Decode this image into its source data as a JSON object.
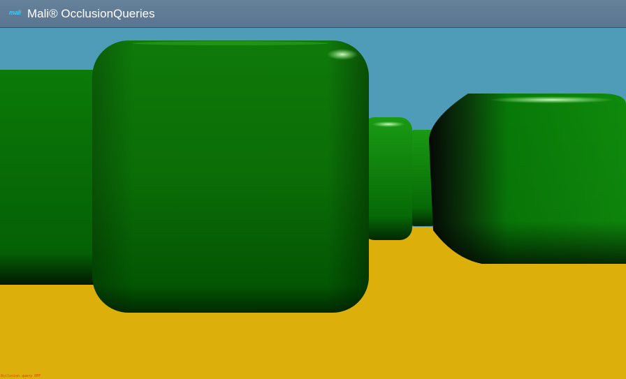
{
  "app": {
    "logo_text": "mali",
    "title": "Mali® OcclusionQueries"
  },
  "status": {
    "text": "Occlusion query OFF"
  },
  "colors": {
    "titlebar": "#5f7a94",
    "sky": "#4e9cb8",
    "ground": "#dcaf0a",
    "cube_green": "#1f8a12",
    "status_text": "#ff2200"
  }
}
